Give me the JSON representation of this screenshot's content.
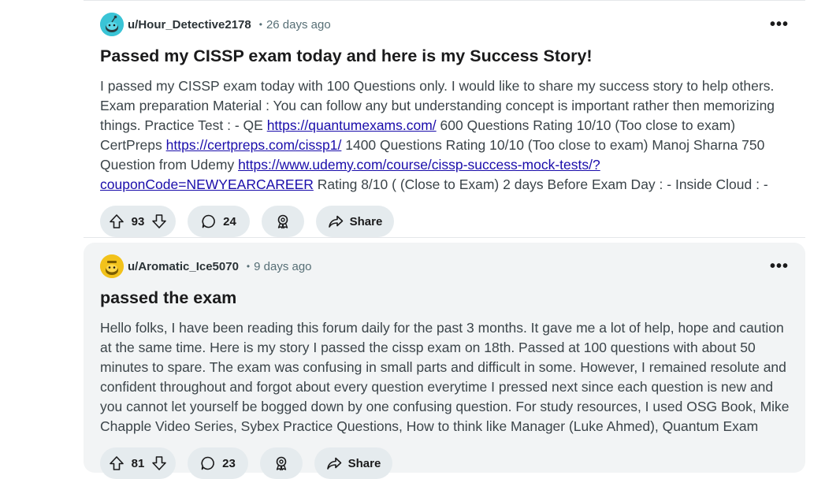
{
  "posts": [
    {
      "username": "u/Hour_Detective2178",
      "separator": "•",
      "time": "26 days ago",
      "more_label": "•••",
      "title": "Passed my CISSP exam today and here is my Success Story!",
      "body": {
        "t1": "I passed my CISSP exam today with 100 Questions only. I would like to share my success story to help others. Exam preparation Material : You can follow any but understanding concept is important rather then memorizing things. Practice Test : - QE ",
        "link1": "https://quantumexams.com/",
        "t2": " 600 Questions Rating 10/10 (Too close to exam) CertPreps ",
        "link2": "https://certpreps.com/cissp1/",
        "t3": " 1400 Questions Rating 10/10 (Too close to exam) Manoj Sharna 750 Question from Udemy ",
        "link3a": "https://www.udemy.com/course/cissp-success-mock-tests/?",
        "link3b": "couponCode=NEWYEARCAREER",
        "t4": " Rating 8/10 ( (Close to Exam) 2 days Before Exam Day : - Inside Cloud : - How t..."
      },
      "votes": "93",
      "comments": "24",
      "share_label": "Share",
      "avatar_color": "#3ac4d6"
    },
    {
      "username": "u/Aromatic_Ice5070",
      "separator": "•",
      "time": "9 days ago",
      "more_label": "•••",
      "title": "passed the exam",
      "body": {
        "t1": "Hello folks, I have been reading this forum daily for the past 3 months. It gave me a lot of help, hope and caution at the same time. Here is my story I passed the cissp exam on 18th. Passed at 100 questions with about 50 minutes to spare. The exam was confusing in small parts and difficult in some. However, I remained resolute and confident throughout and forgot about every question everytime I pressed next since each question is new and you cannot let yourself be bogged down by one confusing question. For study resources, I used OSG Book, Mike Chapple Video Series, Sybex Practice Questions, How to think like Manager (Luke Ahmed), Quantum Exam and..."
      },
      "votes": "81",
      "comments": "23",
      "share_label": "Share",
      "avatar_color": "#f2c21b"
    }
  ],
  "colors": {
    "link": "#1a0dab",
    "pill_bg": "#e5ebee",
    "hover_card_bg": "#f2f4f5"
  },
  "icons": [
    "upvote-icon",
    "downvote-icon",
    "comment-icon",
    "award-icon",
    "share-icon",
    "more-options-icon"
  ]
}
